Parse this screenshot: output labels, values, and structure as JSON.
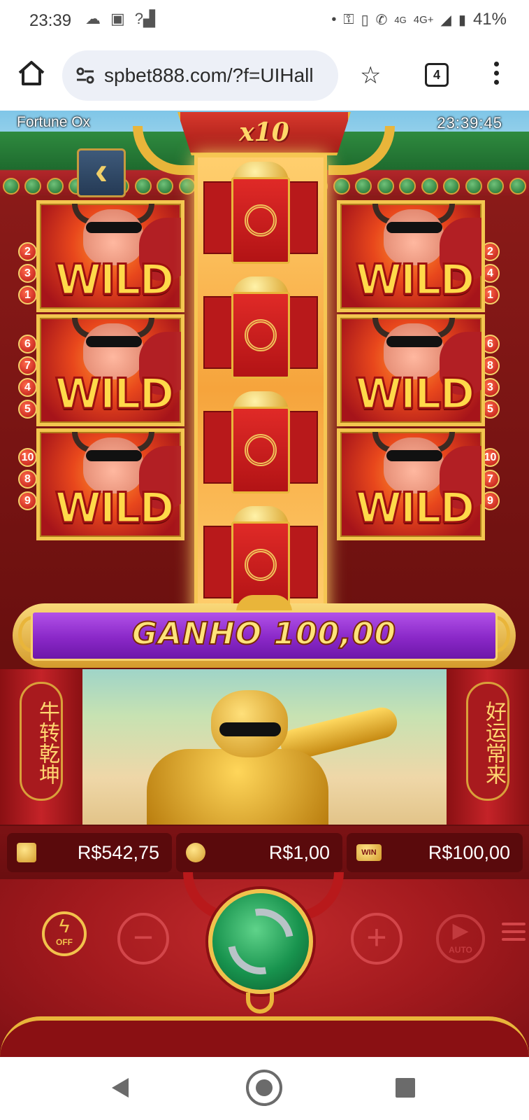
{
  "status_bar": {
    "time": "23:39",
    "network_labels": [
      "4G",
      "4G+"
    ],
    "battery": "41%",
    "icons": [
      "cloud-icon",
      "app-notification-icon",
      "no-signal-icon",
      "key-icon",
      "vibrate-icon",
      "wifi-calling-icon",
      "signal-icon",
      "battery-icon"
    ]
  },
  "browser": {
    "url": "spbet888.com/?f=UIHall",
    "tab_count": "4",
    "icons": [
      "home-icon",
      "site-settings-icon",
      "bookmark-star-icon",
      "tabs-icon",
      "more-vert-icon"
    ]
  },
  "game": {
    "title": "Fortune Ox",
    "clock": "23:39:45",
    "multiplier": "x10",
    "reels": {
      "left_column": [
        {
          "symbol": "WILD",
          "paylines": [
            "2",
            "3",
            "1"
          ]
        },
        {
          "symbol": "WILD",
          "paylines": [
            "6",
            "7",
            "4",
            "5"
          ]
        },
        {
          "symbol": "WILD",
          "paylines": [
            "10",
            "8",
            "9"
          ]
        }
      ],
      "center_column": [
        "red-envelope",
        "red-envelope",
        "red-envelope",
        "red-envelope"
      ],
      "right_column": [
        {
          "symbol": "WILD",
          "paylines": [
            "2",
            "4",
            "1"
          ]
        },
        {
          "symbol": "WILD",
          "paylines": [
            "6",
            "8",
            "3",
            "5"
          ]
        },
        {
          "symbol": "WILD",
          "paylines": [
            "10",
            "7",
            "9"
          ]
        }
      ]
    },
    "win_banner": "GANHO 100,00",
    "couplets": {
      "left": "牛转乾坤",
      "right": "好运常来"
    },
    "balances": {
      "balance": "R$542,75",
      "bet": "R$1,00",
      "win": "R$100,00",
      "win_icon_label": "WIN"
    },
    "controls": {
      "turbo_label": "OFF",
      "minus": "−",
      "plus": "+",
      "auto_label": "AUTO"
    },
    "colors": {
      "accent_gold": "#e9b53a",
      "win_purple": "#8a28c8",
      "spin_green": "#18934e",
      "background_red": "#a31a1e"
    }
  },
  "nav_bar": {
    "icons": [
      "back-icon",
      "home-circle-icon",
      "recents-icon"
    ]
  }
}
